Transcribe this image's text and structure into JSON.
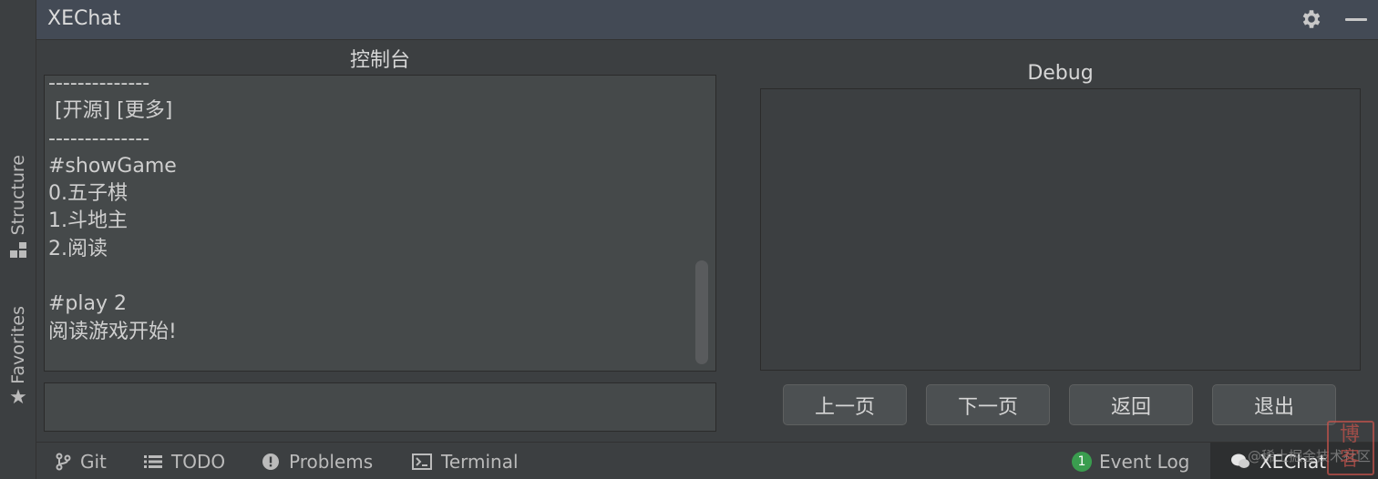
{
  "header": {
    "title": "XEChat",
    "settings_icon": "gear-icon",
    "minimize_icon": "minimize-icon"
  },
  "left_stripe": {
    "tabs": [
      {
        "label": "Structure",
        "icon": "structure-icon"
      },
      {
        "label": "Favorites",
        "icon": "star-icon"
      }
    ]
  },
  "console": {
    "title": "控制台",
    "lines": [
      "--------------",
      " [开源] [更多]",
      "--------------",
      "#showGame",
      "0.五子棋",
      "1.斗地主",
      "2.阅读",
      "",
      "#play 2",
      "阅读游戏开始!"
    ],
    "input_value": ""
  },
  "debug": {
    "title": "Debug",
    "buttons": {
      "prev": "上一页",
      "next": "下一页",
      "back": "返回",
      "exit": "退出"
    }
  },
  "bottom_bar": {
    "items": [
      {
        "label": "Git",
        "icon": "git-branch-icon"
      },
      {
        "label": "TODO",
        "icon": "list-icon"
      },
      {
        "label": "Problems",
        "icon": "problems-icon"
      },
      {
        "label": "Terminal",
        "icon": "terminal-icon"
      }
    ],
    "event_log": {
      "label": "Event Log",
      "count": "1"
    },
    "xechat": {
      "label": "XEChat",
      "icon": "chat-icon"
    },
    "watermark": "@稀土掘金技术社区"
  },
  "seal_text": "博​客"
}
